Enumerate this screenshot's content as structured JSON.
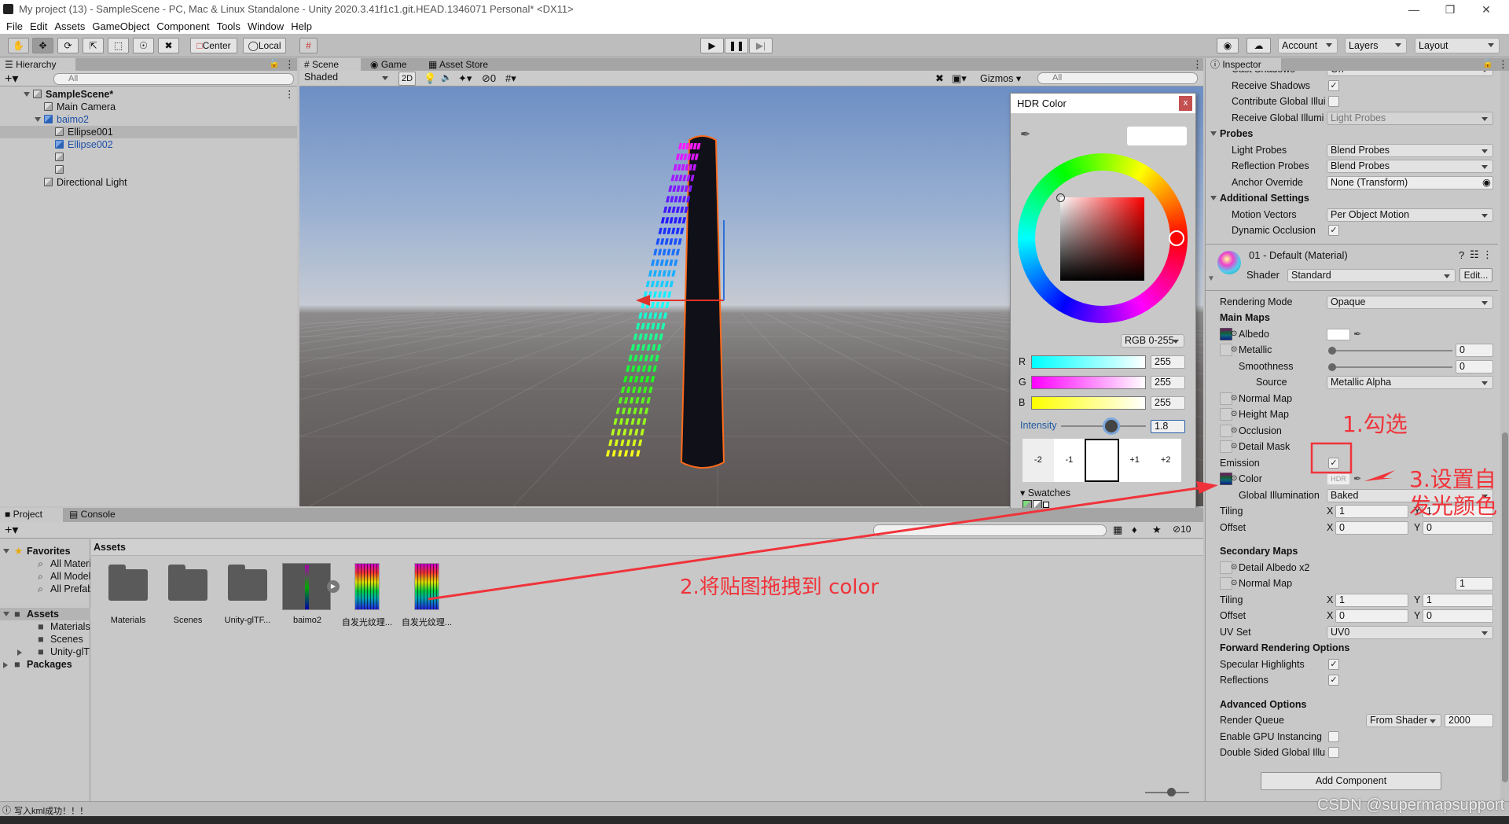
{
  "window": {
    "title": "My project (13) - SampleScene - PC, Mac & Linux Standalone - Unity 2020.3.41f1c1.git.HEAD.1346071 Personal* <DX11>"
  },
  "menu": [
    "File",
    "Edit",
    "Assets",
    "GameObject",
    "Component",
    "Tools",
    "Window",
    "Help"
  ],
  "toolbar": {
    "center_label": "Center",
    "local_label": "Local",
    "account_label": "Account",
    "layers_label": "Layers",
    "layout_label": "Layout"
  },
  "hierarchy": {
    "tab": "Hierarchy",
    "search_placeholder": "All",
    "items": [
      {
        "label": "SampleScene*",
        "depth": 0,
        "expand": "down",
        "icon": "scene",
        "bold": true
      },
      {
        "label": "Main Camera",
        "depth": 1,
        "icon": "cube"
      },
      {
        "label": "baimo2",
        "depth": 1,
        "expand": "down",
        "icon": "prefab",
        "blue": true
      },
      {
        "label": "Ellipse001",
        "depth": 2,
        "icon": "cube",
        "selected": true
      },
      {
        "label": "Ellipse002",
        "depth": 2,
        "icon": "cube",
        "blue": true
      },
      {
        "label": "",
        "depth": 2,
        "icon": "cube"
      },
      {
        "label": "",
        "depth": 2,
        "icon": "cube"
      },
      {
        "label": "Directional Light",
        "depth": 1,
        "icon": "cube"
      }
    ]
  },
  "scene": {
    "tabs": [
      "Scene",
      "Game",
      "Asset Store"
    ],
    "shading": "Shaded",
    "mode_2d": "2D",
    "hidden_count": "0",
    "gizmos": "Gizmos",
    "search_placeholder": "All"
  },
  "hdr_color": {
    "title": "HDR Color",
    "close": "x",
    "mode": "RGB 0-255",
    "channels": [
      {
        "name": "R",
        "value": "255"
      },
      {
        "name": "G",
        "value": "255"
      },
      {
        "name": "B",
        "value": "255"
      }
    ],
    "intensity_label": "Intensity",
    "intensity": "1.8",
    "exposure": [
      "-2",
      "-1",
      "",
      "+1",
      "+2"
    ],
    "swatches_label": "Swatches"
  },
  "inspector": {
    "tab": "Inspector",
    "rows": [
      {
        "kind": "dropdown",
        "label": "Cast Shadows",
        "value": "On"
      },
      {
        "kind": "check",
        "label": "Receive Shadows",
        "checked": true
      },
      {
        "kind": "check",
        "label": "Contribute Global Illui",
        "checked": false
      },
      {
        "kind": "dropdown",
        "label": "Receive Global Illumi",
        "value": "Light Probes",
        "disabled": true
      },
      {
        "kind": "header",
        "label": "Probes"
      },
      {
        "kind": "dropdown",
        "label": "Light Probes",
        "value": "Blend Probes"
      },
      {
        "kind": "dropdown",
        "label": "Reflection Probes",
        "value": "Blend Probes"
      },
      {
        "kind": "object",
        "label": "Anchor Override",
        "value": "None (Transform)"
      },
      {
        "kind": "header",
        "label": "Additional Settings"
      },
      {
        "kind": "dropdown",
        "label": "Motion Vectors",
        "value": "Per Object Motion"
      },
      {
        "kind": "check",
        "label": "Dynamic Occlusion",
        "checked": true
      }
    ],
    "material": {
      "title": "01 - Default (Material)",
      "shader_label": "Shader",
      "shader": "Standard",
      "edit": "Edit..."
    },
    "mat_rows": [
      {
        "kind": "dropdown",
        "label": "Rendering Mode",
        "value": "Opaque"
      },
      {
        "kind": "sub",
        "label": "Main Maps"
      },
      {
        "kind": "tex",
        "label": "Albedo",
        "tex": true,
        "color": "#ffffff"
      },
      {
        "kind": "tex",
        "label": "Metallic",
        "slider": 0,
        "num": "0"
      },
      {
        "kind": "ind",
        "label": "Smoothness",
        "slider": 0,
        "num": "0"
      },
      {
        "kind": "ind2",
        "label": "Source",
        "value": "Metallic Alpha"
      },
      {
        "kind": "tex",
        "label": "Normal Map"
      },
      {
        "kind": "tex",
        "label": "Height Map"
      },
      {
        "kind": "tex",
        "label": "Occlusion"
      },
      {
        "kind": "tex",
        "label": "Detail Mask"
      },
      {
        "kind": "mcheck",
        "label": "Emission",
        "checked": true
      },
      {
        "kind": "tex",
        "label": "Color",
        "tex": true,
        "hdr": "HDR"
      },
      {
        "kind": "ind",
        "label": "Global Illumination",
        "value": "Baked"
      },
      {
        "kind": "xy",
        "label": "Tiling",
        "x": "1",
        "y": "1"
      },
      {
        "kind": "xy",
        "label": "Offset",
        "x": "0",
        "y": "0"
      },
      {
        "kind": "spacer"
      },
      {
        "kind": "sub",
        "label": "Secondary Maps"
      },
      {
        "kind": "tex",
        "label": "Detail Albedo x2"
      },
      {
        "kind": "tex",
        "label": "Normal Map",
        "num": "1"
      },
      {
        "kind": "xy",
        "label": "Tiling",
        "x": "1",
        "y": "1"
      },
      {
        "kind": "xy",
        "label": "Offset",
        "x": "0",
        "y": "0"
      },
      {
        "kind": "dropdown",
        "label": "UV Set",
        "value": "UV0"
      },
      {
        "kind": "sub",
        "label": "Forward Rendering Options"
      },
      {
        "kind": "mcheck",
        "label": "Specular Highlights",
        "checked": true
      },
      {
        "kind": "mcheck",
        "label": "Reflections",
        "checked": true
      },
      {
        "kind": "spacer"
      },
      {
        "kind": "sub",
        "label": "Advanced Options"
      },
      {
        "kind": "queue",
        "label": "Render Queue",
        "value": "From Shader",
        "num": "2000"
      },
      {
        "kind": "mcheck",
        "label": "Enable GPU Instancing",
        "checked": false
      },
      {
        "kind": "mcheck",
        "label": "Double Sided Global Illu",
        "checked": false
      }
    ],
    "add_component": "Add Component"
  },
  "project": {
    "tabs": [
      "Project",
      "Console"
    ],
    "hidden_count": "10",
    "tree": [
      {
        "label": "Favorites",
        "depth": 0,
        "bold": true,
        "icon": "star",
        "expand": "down"
      },
      {
        "label": "All Materials",
        "depth": 1,
        "icon": "search"
      },
      {
        "label": "All Models",
        "depth": 1,
        "icon": "search"
      },
      {
        "label": "All Prefabs",
        "depth": 1,
        "icon": "search"
      },
      {
        "label": "",
        "depth": 0,
        "icon": "none"
      },
      {
        "label": "Assets",
        "depth": 0,
        "bold": true,
        "icon": "folder",
        "expand": "down",
        "selected": true
      },
      {
        "label": "Materials",
        "depth": 1,
        "icon": "folder"
      },
      {
        "label": "Scenes",
        "depth": 1,
        "icon": "folder"
      },
      {
        "label": "Unity-glTF-",
        "depth": 1,
        "icon": "folder",
        "expand": "right"
      },
      {
        "label": "Packages",
        "depth": 0,
        "bold": true,
        "icon": "folder",
        "expand": "right"
      }
    ],
    "breadcrumb": "Assets",
    "assets": [
      {
        "label": "Materials",
        "type": "folder"
      },
      {
        "label": "Scenes",
        "type": "folder"
      },
      {
        "label": "Unity-glTF...",
        "type": "folder"
      },
      {
        "label": "baimo2",
        "type": "model"
      },
      {
        "label": "自发光纹理...",
        "type": "texture"
      },
      {
        "label": "自发光纹理...",
        "type": "texture"
      }
    ]
  },
  "status": {
    "message": "写入kml成功！！！"
  },
  "annotations": {
    "step1": "1.勾选",
    "step2": "2.将贴图拖拽到 color",
    "step3_line1": "3.设置自",
    "step3_line2": "发光颜色",
    "color": "#f0333a"
  },
  "watermark": "CSDN @supermapsupport"
}
